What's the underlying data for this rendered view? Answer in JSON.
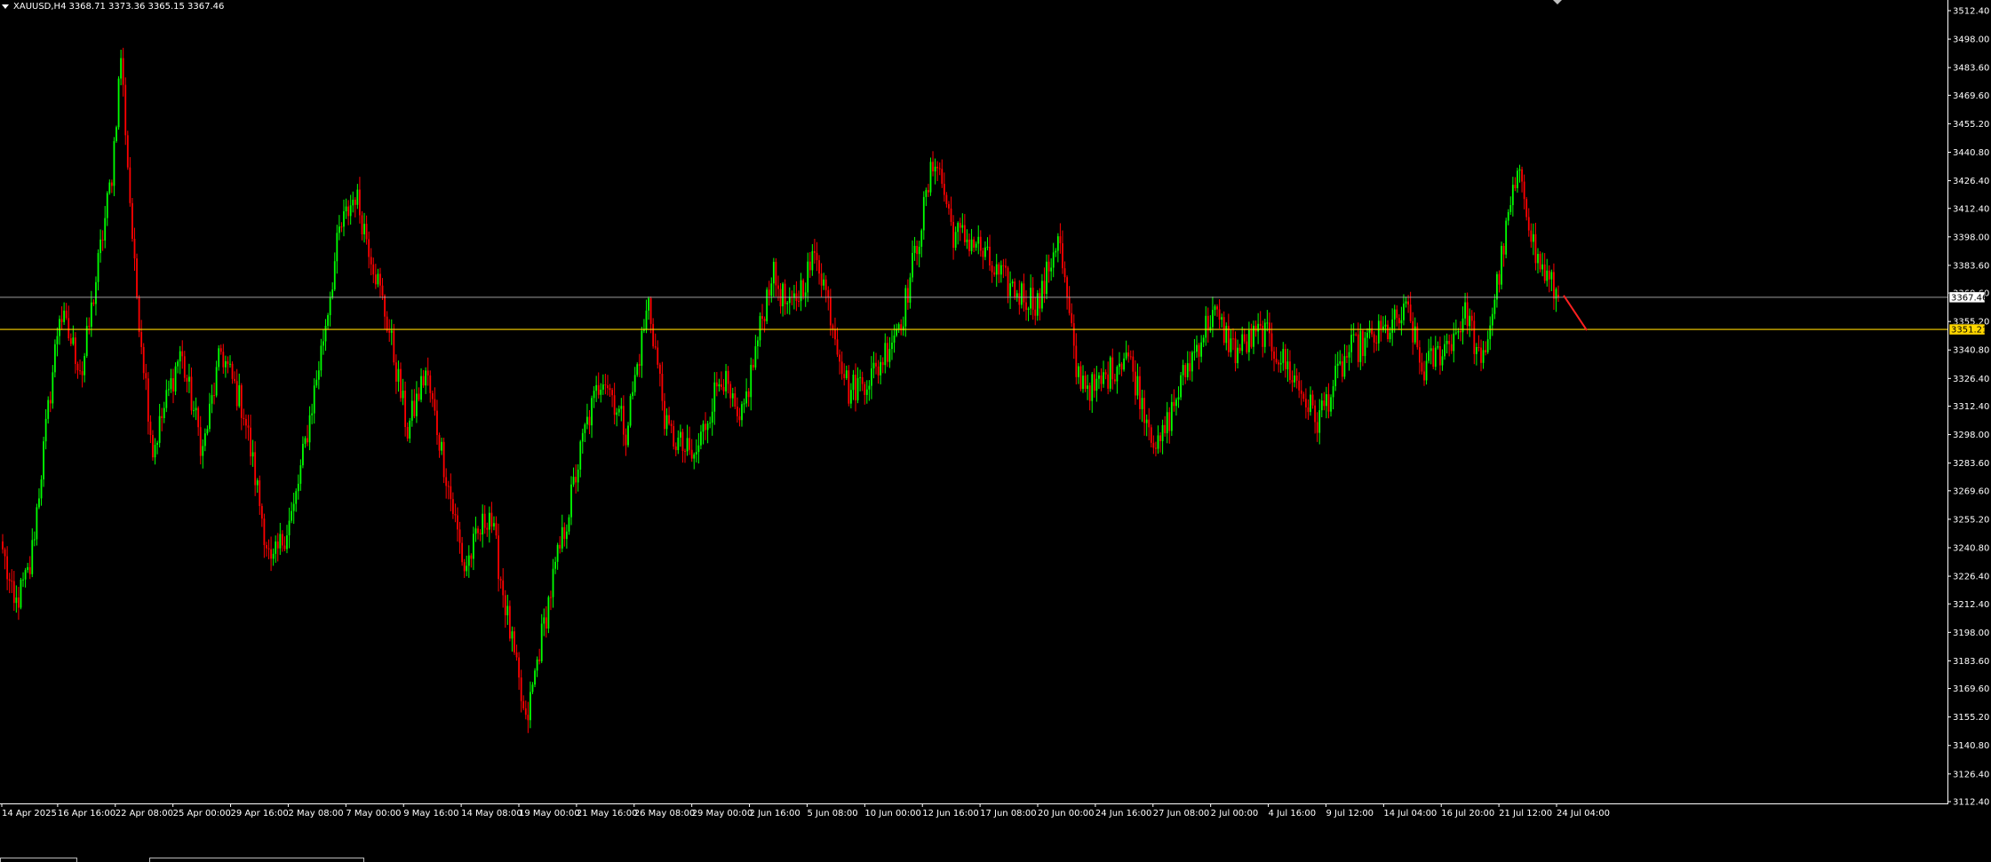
{
  "info": {
    "symbol_tf": "XAUUSD,H4",
    "ohlc": "3368.71 3373.36 3365.15 3367.46"
  },
  "colors": {
    "background": "#000000",
    "bull": "#00ff00",
    "bear": "#ff0000",
    "bid_line": "#c0c0c0",
    "level_line": "#ffd700",
    "axis": "#ffffff",
    "trend": "#ff2020"
  },
  "price_axis": {
    "labels": [
      "3512.40",
      "3498.00",
      "3483.60",
      "3469.60",
      "3455.20",
      "3440.80",
      "3426.40",
      "3412.40",
      "3398.00",
      "3383.60",
      "3369.60",
      "3355.20",
      "3340.80",
      "3326.40",
      "3312.40",
      "3298.00",
      "3283.60",
      "3269.60",
      "3255.20",
      "3240.80",
      "3226.40",
      "3212.40",
      "3198.00",
      "3183.60",
      "3169.60",
      "3155.20",
      "3140.80",
      "3126.40",
      "3112.40"
    ],
    "current_price": "3367.46",
    "level_price": "3351.21"
  },
  "time_axis": {
    "labels": [
      "14 Apr 2025",
      "16 Apr 16:00",
      "22 Apr 08:00",
      "25 Apr 00:00",
      "29 Apr 16:00",
      "2 May 08:00",
      "7 May 00:00",
      "9 May 16:00",
      "14 May 08:00",
      "19 May 00:00",
      "21 May 16:00",
      "26 May 08:00",
      "29 May 00:00",
      "2 Jun 16:00",
      "5 Jun 08:00",
      "10 Jun 00:00",
      "12 Jun 16:00",
      "17 Jun 08:00",
      "20 Jun 00:00",
      "24 Jun 16:00",
      "27 Jun 08:00",
      "2 Jul 00:00",
      "4 Jul 16:00",
      "9 Jul 12:00",
      "14 Jul 04:00",
      "16 Jul 20:00",
      "21 Jul 12:00",
      "24 Jul 04:00"
    ]
  },
  "chart_data": {
    "type": "candlestick",
    "symbol": "XAUUSD",
    "timeframe": "H4",
    "ylim": [
      3112.4,
      3512.4
    ],
    "anchors": [
      [
        0,
        3240
      ],
      [
        5,
        3210
      ],
      [
        12,
        3230
      ],
      [
        25,
        3360
      ],
      [
        35,
        3330
      ],
      [
        48,
        3430
      ],
      [
        52,
        3490
      ],
      [
        58,
        3380
      ],
      [
        66,
        3290
      ],
      [
        78,
        3340
      ],
      [
        88,
        3290
      ],
      [
        96,
        3340
      ],
      [
        106,
        3310
      ],
      [
        118,
        3230
      ],
      [
        128,
        3260
      ],
      [
        140,
        3340
      ],
      [
        148,
        3400
      ],
      [
        155,
        3420
      ],
      [
        162,
        3390
      ],
      [
        170,
        3350
      ],
      [
        178,
        3300
      ],
      [
        186,
        3330
      ],
      [
        193,
        3290
      ],
      [
        203,
        3230
      ],
      [
        214,
        3260
      ],
      [
        230,
        3150
      ],
      [
        236,
        3190
      ],
      [
        242,
        3225
      ],
      [
        248,
        3255
      ],
      [
        256,
        3300
      ],
      [
        264,
        3330
      ],
      [
        274,
        3300
      ],
      [
        284,
        3365
      ],
      [
        292,
        3300
      ],
      [
        304,
        3285
      ],
      [
        316,
        3330
      ],
      [
        324,
        3300
      ],
      [
        338,
        3380
      ],
      [
        346,
        3360
      ],
      [
        358,
        3390
      ],
      [
        372,
        3320
      ],
      [
        384,
        3330
      ],
      [
        396,
        3360
      ],
      [
        410,
        3440
      ],
      [
        418,
        3400
      ],
      [
        428,
        3395
      ],
      [
        436,
        3380
      ],
      [
        446,
        3370
      ],
      [
        456,
        3365
      ],
      [
        464,
        3400
      ],
      [
        472,
        3330
      ],
      [
        480,
        3320
      ],
      [
        494,
        3340
      ],
      [
        508,
        3290
      ],
      [
        520,
        3330
      ],
      [
        532,
        3360
      ],
      [
        542,
        3340
      ],
      [
        554,
        3350
      ],
      [
        566,
        3330
      ],
      [
        578,
        3305
      ],
      [
        592,
        3340
      ],
      [
        608,
        3350
      ],
      [
        618,
        3360
      ],
      [
        624,
        3330
      ],
      [
        636,
        3345
      ],
      [
        644,
        3360
      ],
      [
        650,
        3330
      ],
      [
        658,
        3380
      ],
      [
        664,
        3420
      ],
      [
        668,
        3428
      ],
      [
        674,
        3388
      ],
      [
        680,
        3375
      ],
      [
        684,
        3367.46
      ]
    ],
    "last_candle": {
      "open": 3368.71,
      "high": 3373.36,
      "low": 3365.15,
      "close": 3367.46
    },
    "horizontal_lines": [
      3367.46,
      3351.21
    ],
    "trend_line": {
      "from": 3367.46,
      "to": 3351.21
    }
  }
}
